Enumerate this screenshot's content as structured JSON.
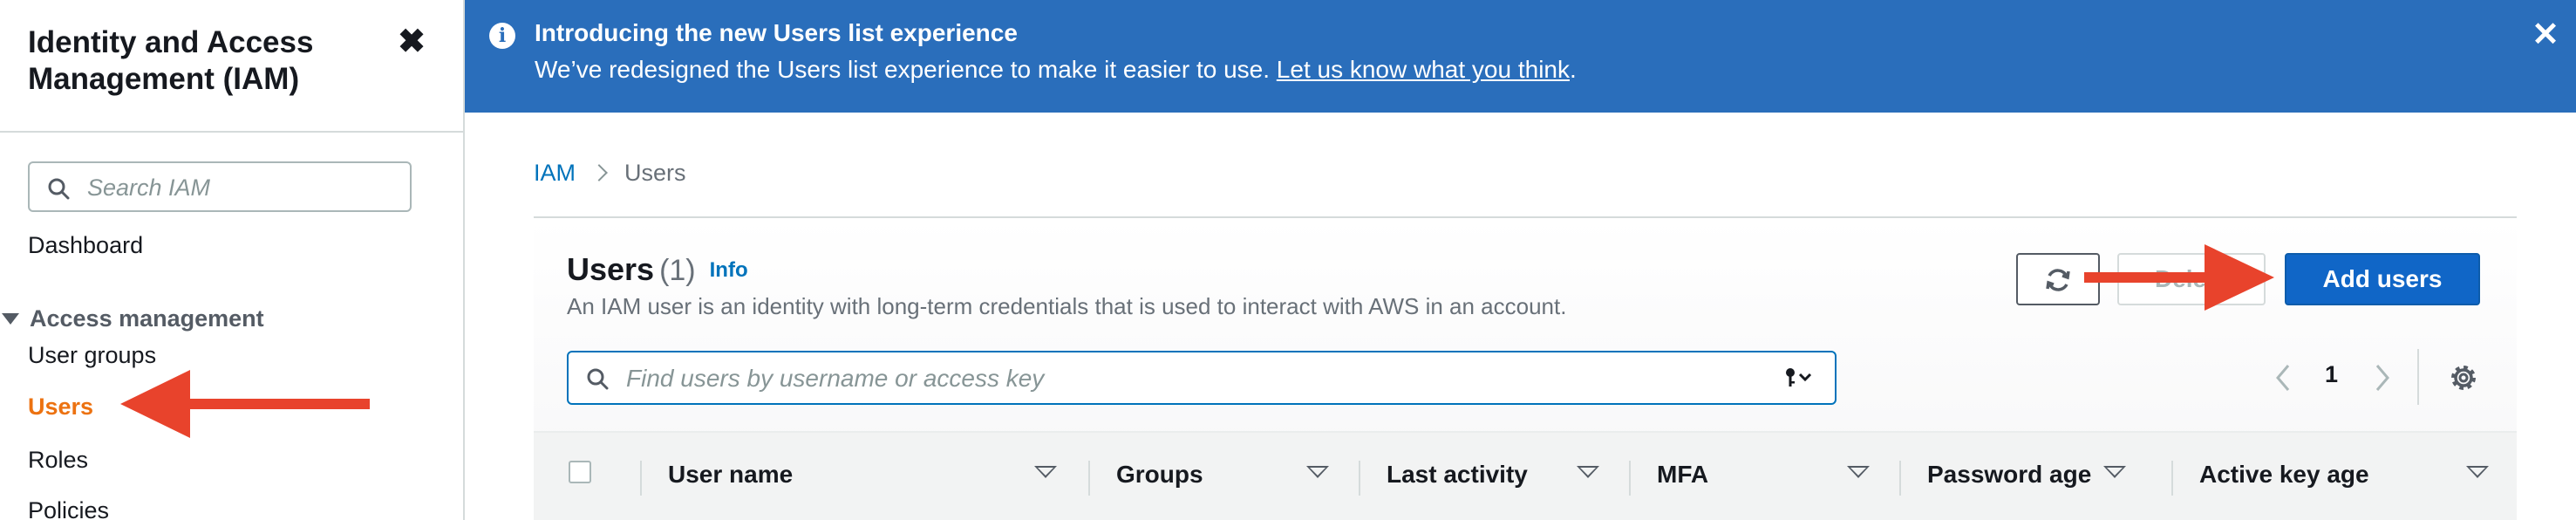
{
  "sidebar": {
    "title": "Identity and Access Management (IAM)",
    "close_icon": "close-icon",
    "search_placeholder": "Search IAM",
    "dashboard": "Dashboard",
    "section": "Access management",
    "items": [
      {
        "label": "User groups",
        "active": false
      },
      {
        "label": "Users",
        "active": true
      },
      {
        "label": "Roles",
        "active": false
      },
      {
        "label": "Policies",
        "active": false
      }
    ]
  },
  "banner": {
    "title": "Introducing the new Users list experience",
    "text": "We’ve redesigned the Users list experience to make it easier to use.",
    "link": "Let us know what you think",
    "link_suffix": ".",
    "color": "#2a6ebb"
  },
  "breadcrumb": {
    "root": "IAM",
    "current": "Users"
  },
  "users": {
    "heading": "Users",
    "count": "(1)",
    "info": "Info",
    "description": "An IAM user is an identity with long-term credentials that is used to interact with AWS in an account.",
    "refresh_icon": "refresh-icon",
    "delete_label": "Delete",
    "add_label": "Add users",
    "search_placeholder": "Find users by username or access key",
    "filter_icon": "key-icon",
    "page": "1",
    "settings_icon": "gear-icon",
    "columns": [
      "User name",
      "Groups",
      "Last activity",
      "MFA",
      "Password age",
      "Active key age"
    ]
  },
  "colors": {
    "accent": "#0073bb",
    "primary_button": "#1066c7",
    "active_nav": "#ec7211",
    "annotation_arrow": "#e8432c"
  }
}
